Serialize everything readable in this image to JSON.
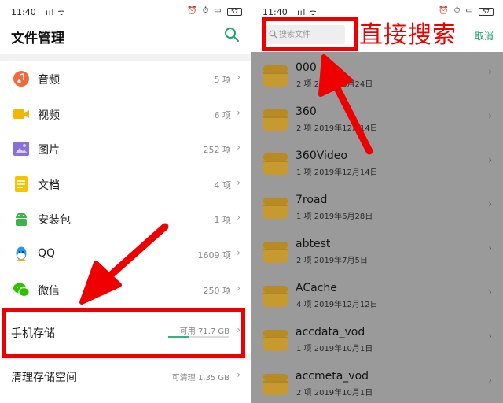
{
  "left_screen": {
    "status": {
      "time": "11:40",
      "signal": "ııl ᯤ",
      "icons": "⏰ ⏱ ▭",
      "battery": "57"
    },
    "title": "文件管理",
    "categories": [
      {
        "label": "音频",
        "count": "5 项",
        "icon": "music-icon",
        "color": "#f06a3b"
      },
      {
        "label": "视频",
        "count": "6 项",
        "icon": "video-icon",
        "color": "#f5b400"
      },
      {
        "label": "图片",
        "count": "252 项",
        "icon": "image-icon",
        "color": "#8a6fd8"
      },
      {
        "label": "文档",
        "count": "4 项",
        "icon": "document-icon",
        "color": "#f5c400"
      },
      {
        "label": "安装包",
        "count": "1 项",
        "icon": "android-icon",
        "color": "#3cb44b"
      },
      {
        "label": "QQ",
        "count": "1609 项",
        "icon": "qq-icon",
        "color": "#1d9bf0"
      },
      {
        "label": "微信",
        "count": "250 项",
        "icon": "wechat-icon",
        "color": "#2dc100"
      }
    ],
    "storage": {
      "label": "手机存储",
      "free": "可用 71.7 GB",
      "used_fraction": 0.35
    },
    "clean": {
      "label": "清理存储空间",
      "size": "可清理 1.35 GB"
    },
    "chevron": "›",
    "accent": "#21a366",
    "annotation_color": "#ee0000"
  },
  "right_screen": {
    "status": {
      "time": "11:40",
      "signal": "ııl ᯤ",
      "icons": "⏰ ⏱ ▭",
      "battery": "57"
    },
    "search_placeholder": "搜索文件",
    "cancel": "取消",
    "annotation": "直接搜索",
    "folders": [
      {
        "name": "000",
        "meta": "2 项 2019年6月24日"
      },
      {
        "name": "360",
        "meta": "2 项 2019年12月14日"
      },
      {
        "name": "360Video",
        "meta": "1 项 2019年12月14日"
      },
      {
        "name": "7road",
        "meta": "1 项 2019年6月28日"
      },
      {
        "name": "abtest",
        "meta": "2 项 2019年7月5日"
      },
      {
        "name": "ACache",
        "meta": "4 项 2019年12月12日"
      },
      {
        "name": "accdata_vod",
        "meta": "1 项 2019年10月1日"
      },
      {
        "name": "accmeta_vod",
        "meta": "2 项 2019年10月1日"
      }
    ],
    "folder_color": "#c79a2f"
  }
}
